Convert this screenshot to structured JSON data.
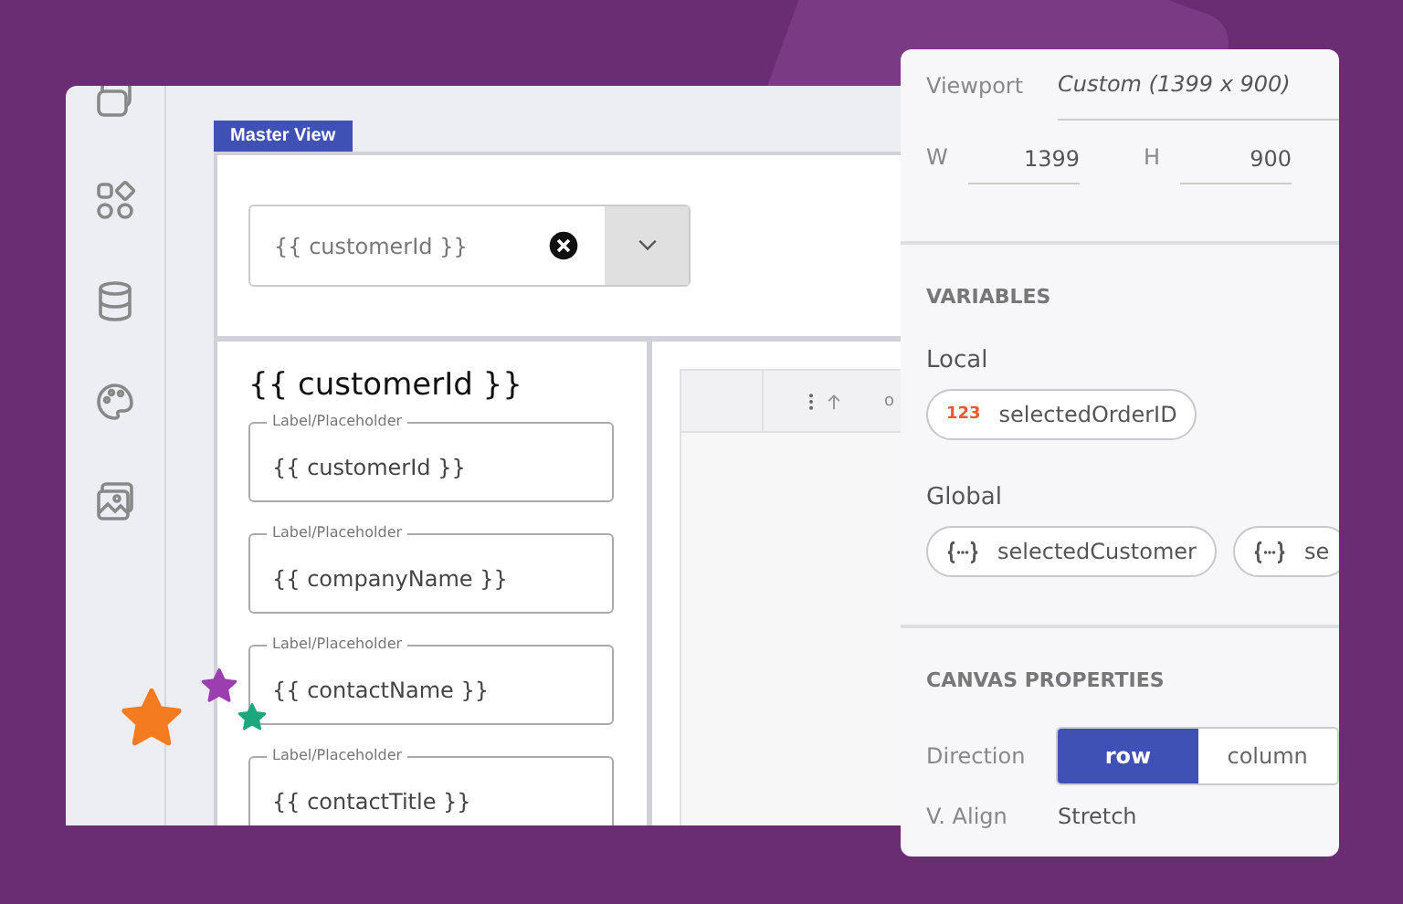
{
  "master_view": {
    "tab": "Master View",
    "combo": {
      "value": "{{ customerId }}"
    },
    "detail": {
      "title": "{{ customerId }}",
      "fields": [
        {
          "label": "Label/Placeholder",
          "value": "{{ customerId }}"
        },
        {
          "label": "Label/Placeholder",
          "value": "{{ companyName }}"
        },
        {
          "label": "Label/Placeholder",
          "value": "{{ contactName }}"
        },
        {
          "label": "Label/Placeholder",
          "value": "{{ contactTitle }}"
        }
      ]
    },
    "grid": {
      "column_2": "o"
    }
  },
  "properties": {
    "viewport": {
      "label": "Viewport",
      "value": "Custom (1399 x 900)"
    },
    "width": {
      "label": "W",
      "value": "1399"
    },
    "height": {
      "label": "H",
      "value": "900"
    },
    "variables": {
      "title": "VARIABLES",
      "local": {
        "label": "Local",
        "items": [
          {
            "kind": "number",
            "badge": "123",
            "name": "selectedOrderID"
          }
        ]
      },
      "global": {
        "label": "Global",
        "items": [
          {
            "kind": "object",
            "name": "selectedCustomer"
          },
          {
            "kind": "object",
            "name": "se"
          }
        ]
      }
    },
    "canvas": {
      "title": "CANVAS PROPERTIES",
      "direction": {
        "label": "Direction",
        "options": [
          {
            "label": "row",
            "selected": true
          },
          {
            "label": "column",
            "selected": false
          }
        ]
      },
      "v_align": {
        "label": "V. Align",
        "value": "Stretch"
      }
    }
  }
}
